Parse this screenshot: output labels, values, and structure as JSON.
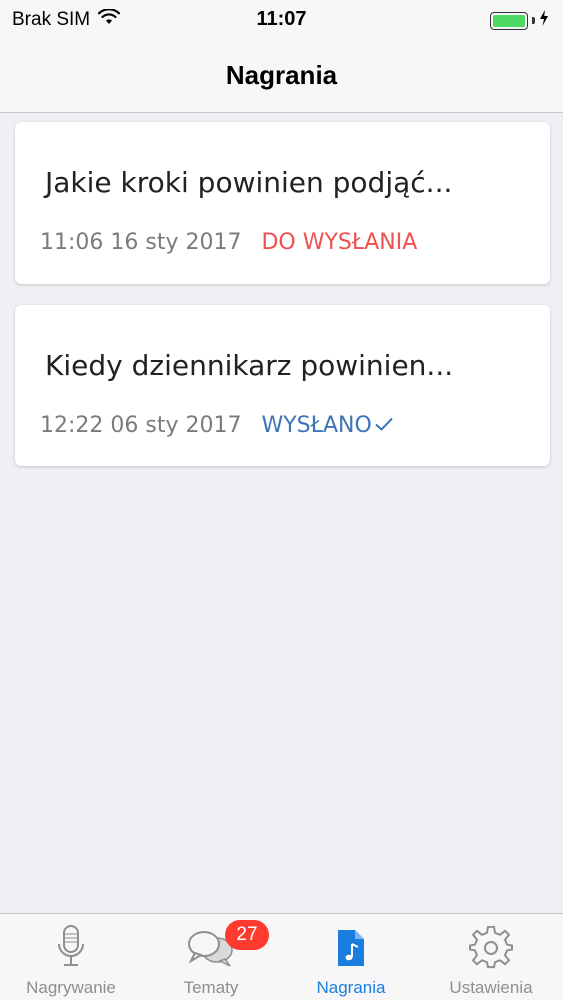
{
  "status_bar": {
    "carrier": "Brak SIM",
    "time": "11:07",
    "battery_color": "#4cd964"
  },
  "nav": {
    "title": "Nagrania"
  },
  "recordings": [
    {
      "title": "Jakie kroki powinien podjąć...",
      "date": "11:06 16 sty 2017",
      "status": "DO WYSŁANIA",
      "status_color": "#ef5050"
    },
    {
      "title": "Kiedy dziennikarz powinien...",
      "date": "12:22 06 sty 2017",
      "status": "WYSŁANO",
      "status_color": "#3d74b7",
      "status_icon": "check-icon"
    }
  ],
  "tabbar": {
    "accent": "#1a7ee0",
    "tabs": [
      {
        "label": "Nagrywanie",
        "icon": "microphone-icon"
      },
      {
        "label": "Tematy",
        "icon": "chat-bubbles-icon",
        "badge": "27"
      },
      {
        "label": "Nagrania",
        "icon": "music-file-icon",
        "active": true
      },
      {
        "label": "Ustawienia",
        "icon": "gear-icon"
      }
    ]
  }
}
